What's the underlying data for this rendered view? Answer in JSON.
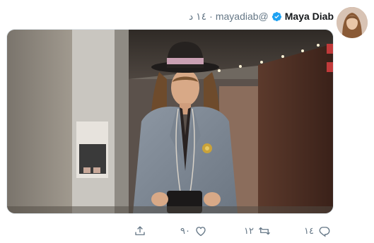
{
  "tweet": {
    "author_name": "Maya Diab",
    "handle": "@mayadiab",
    "separator": "·",
    "time": "١٤ د",
    "reply_count": "١٤",
    "retweet_count": "١٢",
    "like_count": "٩٠"
  },
  "icons": {
    "verified": "verified-badge-icon",
    "reply": "reply-icon",
    "retweet": "retweet-icon",
    "like": "heart-icon",
    "share": "share-icon"
  },
  "colors": {
    "accent": "#1da1f2",
    "muted": "#657786",
    "text": "#14171a"
  }
}
